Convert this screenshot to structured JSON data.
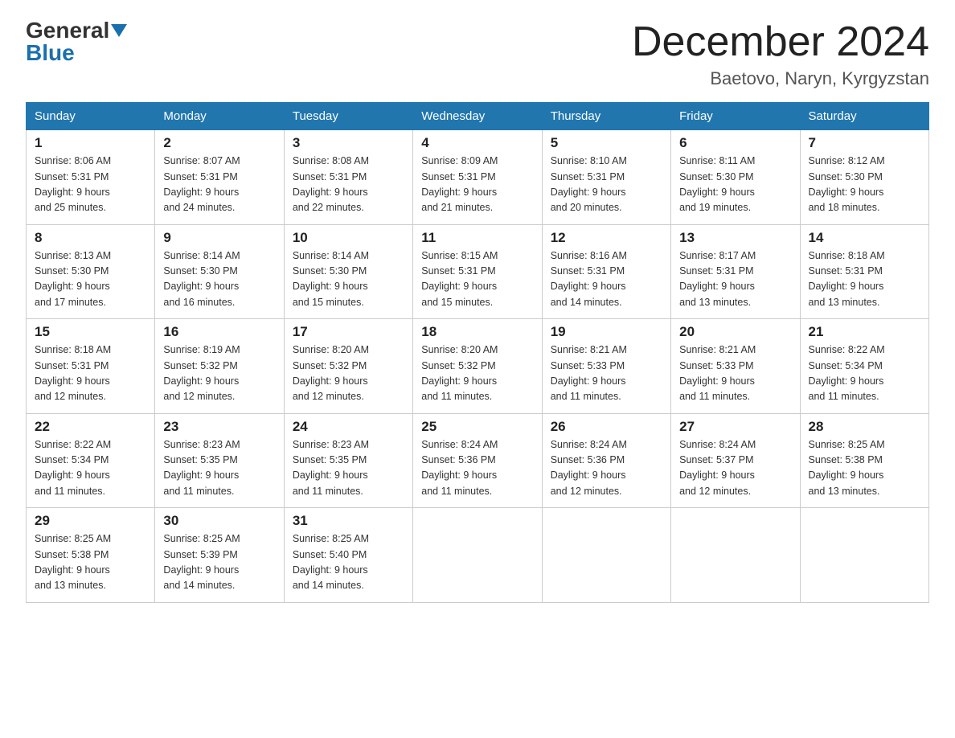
{
  "header": {
    "logo_general": "General",
    "logo_blue": "Blue",
    "month_title": "December 2024",
    "location": "Baetovo, Naryn, Kyrgyzstan"
  },
  "weekdays": [
    "Sunday",
    "Monday",
    "Tuesday",
    "Wednesday",
    "Thursday",
    "Friday",
    "Saturday"
  ],
  "weeks": [
    [
      {
        "day": "1",
        "sunrise": "8:06 AM",
        "sunset": "5:31 PM",
        "daylight": "9 hours and 25 minutes."
      },
      {
        "day": "2",
        "sunrise": "8:07 AM",
        "sunset": "5:31 PM",
        "daylight": "9 hours and 24 minutes."
      },
      {
        "day": "3",
        "sunrise": "8:08 AM",
        "sunset": "5:31 PM",
        "daylight": "9 hours and 22 minutes."
      },
      {
        "day": "4",
        "sunrise": "8:09 AM",
        "sunset": "5:31 PM",
        "daylight": "9 hours and 21 minutes."
      },
      {
        "day": "5",
        "sunrise": "8:10 AM",
        "sunset": "5:31 PM",
        "daylight": "9 hours and 20 minutes."
      },
      {
        "day": "6",
        "sunrise": "8:11 AM",
        "sunset": "5:30 PM",
        "daylight": "9 hours and 19 minutes."
      },
      {
        "day": "7",
        "sunrise": "8:12 AM",
        "sunset": "5:30 PM",
        "daylight": "9 hours and 18 minutes."
      }
    ],
    [
      {
        "day": "8",
        "sunrise": "8:13 AM",
        "sunset": "5:30 PM",
        "daylight": "9 hours and 17 minutes."
      },
      {
        "day": "9",
        "sunrise": "8:14 AM",
        "sunset": "5:30 PM",
        "daylight": "9 hours and 16 minutes."
      },
      {
        "day": "10",
        "sunrise": "8:14 AM",
        "sunset": "5:30 PM",
        "daylight": "9 hours and 15 minutes."
      },
      {
        "day": "11",
        "sunrise": "8:15 AM",
        "sunset": "5:31 PM",
        "daylight": "9 hours and 15 minutes."
      },
      {
        "day": "12",
        "sunrise": "8:16 AM",
        "sunset": "5:31 PM",
        "daylight": "9 hours and 14 minutes."
      },
      {
        "day": "13",
        "sunrise": "8:17 AM",
        "sunset": "5:31 PM",
        "daylight": "9 hours and 13 minutes."
      },
      {
        "day": "14",
        "sunrise": "8:18 AM",
        "sunset": "5:31 PM",
        "daylight": "9 hours and 13 minutes."
      }
    ],
    [
      {
        "day": "15",
        "sunrise": "8:18 AM",
        "sunset": "5:31 PM",
        "daylight": "9 hours and 12 minutes."
      },
      {
        "day": "16",
        "sunrise": "8:19 AM",
        "sunset": "5:32 PM",
        "daylight": "9 hours and 12 minutes."
      },
      {
        "day": "17",
        "sunrise": "8:20 AM",
        "sunset": "5:32 PM",
        "daylight": "9 hours and 12 minutes."
      },
      {
        "day": "18",
        "sunrise": "8:20 AM",
        "sunset": "5:32 PM",
        "daylight": "9 hours and 11 minutes."
      },
      {
        "day": "19",
        "sunrise": "8:21 AM",
        "sunset": "5:33 PM",
        "daylight": "9 hours and 11 minutes."
      },
      {
        "day": "20",
        "sunrise": "8:21 AM",
        "sunset": "5:33 PM",
        "daylight": "9 hours and 11 minutes."
      },
      {
        "day": "21",
        "sunrise": "8:22 AM",
        "sunset": "5:34 PM",
        "daylight": "9 hours and 11 minutes."
      }
    ],
    [
      {
        "day": "22",
        "sunrise": "8:22 AM",
        "sunset": "5:34 PM",
        "daylight": "9 hours and 11 minutes."
      },
      {
        "day": "23",
        "sunrise": "8:23 AM",
        "sunset": "5:35 PM",
        "daylight": "9 hours and 11 minutes."
      },
      {
        "day": "24",
        "sunrise": "8:23 AM",
        "sunset": "5:35 PM",
        "daylight": "9 hours and 11 minutes."
      },
      {
        "day": "25",
        "sunrise": "8:24 AM",
        "sunset": "5:36 PM",
        "daylight": "9 hours and 11 minutes."
      },
      {
        "day": "26",
        "sunrise": "8:24 AM",
        "sunset": "5:36 PM",
        "daylight": "9 hours and 12 minutes."
      },
      {
        "day": "27",
        "sunrise": "8:24 AM",
        "sunset": "5:37 PM",
        "daylight": "9 hours and 12 minutes."
      },
      {
        "day": "28",
        "sunrise": "8:25 AM",
        "sunset": "5:38 PM",
        "daylight": "9 hours and 13 minutes."
      }
    ],
    [
      {
        "day": "29",
        "sunrise": "8:25 AM",
        "sunset": "5:38 PM",
        "daylight": "9 hours and 13 minutes."
      },
      {
        "day": "30",
        "sunrise": "8:25 AM",
        "sunset": "5:39 PM",
        "daylight": "9 hours and 14 minutes."
      },
      {
        "day": "31",
        "sunrise": "8:25 AM",
        "sunset": "5:40 PM",
        "daylight": "9 hours and 14 minutes."
      },
      null,
      null,
      null,
      null
    ]
  ],
  "labels": {
    "sunrise": "Sunrise:",
    "sunset": "Sunset:",
    "daylight": "Daylight:"
  }
}
